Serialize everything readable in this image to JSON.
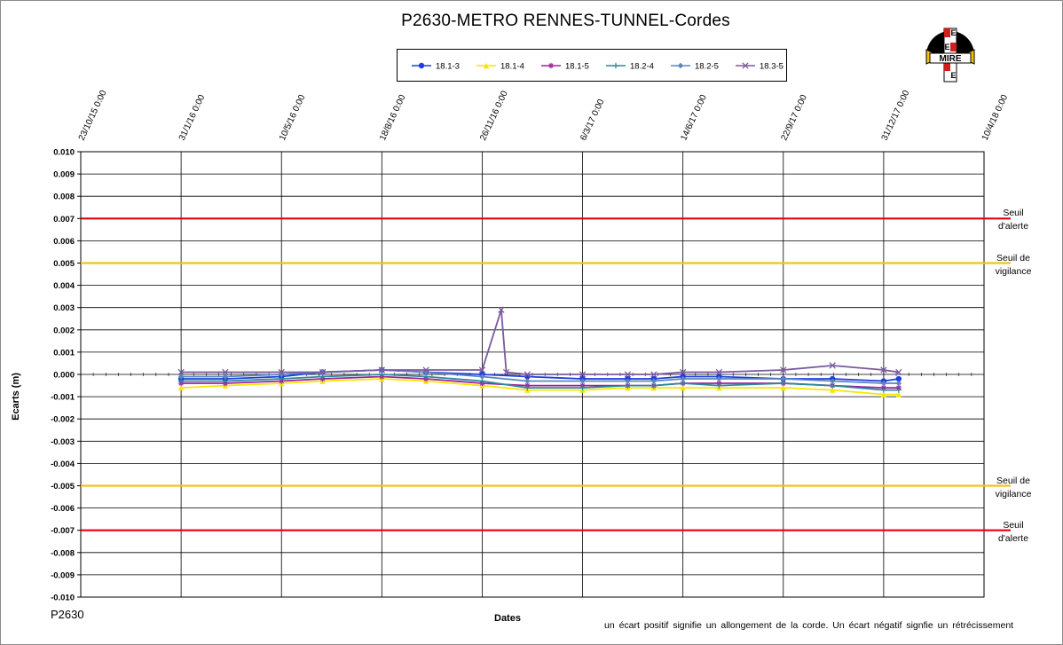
{
  "chart_data": {
    "type": "line",
    "title": "P2630-METRO  RENNES-TUNNEL-Cordes",
    "xlabel": "Dates",
    "ylabel": "Ecarts (m)",
    "x_ticks": [
      "23/10/15 0:00",
      "31/1/16 0:00",
      "10/5/16 0:00",
      "18/8/16 0:00",
      "26/11/16 0:00",
      "6/3/17 0:00",
      "14/6/17 0:00",
      "22/9/17 0:00",
      "31/12/17 0:00",
      "10/4/18 0:00"
    ],
    "x_range": [
      "2015-10-23",
      "2018-04-10"
    ],
    "y_ticks": [
      "0.010",
      "0.009",
      "0.008",
      "0.007",
      "0.006",
      "0.005",
      "0.004",
      "0.003",
      "0.002",
      "0.001",
      "0.000",
      "-0.001",
      "-0.002",
      "-0.003",
      "-0.004",
      "-0.005",
      "-0.006",
      "-0.007",
      "-0.008",
      "-0.009",
      "-0.010"
    ],
    "ylim": [
      -0.01,
      0.01
    ],
    "grid": "horizontal and vertical",
    "legend_position": "top-center",
    "thresholds": [
      {
        "value": 0.007,
        "color": "#e8000b",
        "label_line1": "Seuil",
        "label_line2": "d'alerte"
      },
      {
        "value": 0.005,
        "color": "#f2c01e",
        "label_line1": "Seuil de",
        "label_line2": "vigilance"
      },
      {
        "value": -0.005,
        "color": "#f2c01e",
        "label_line1": "Seuil de",
        "label_line2": "vigilance"
      },
      {
        "value": -0.007,
        "color": "#e8000b",
        "label_line1": "Seuil",
        "label_line2": "d'alerte"
      }
    ],
    "series": [
      {
        "name": "18.1-3",
        "color": "#1f3de0",
        "marker": "circle",
        "x": [
          "2016-01-31",
          "2016-03-15",
          "2016-05-10",
          "2016-06-20",
          "2016-08-18",
          "2016-10-01",
          "2016-11-26",
          "2017-01-10",
          "2017-03-06",
          "2017-04-20",
          "2017-05-16",
          "2017-06-14",
          "2017-07-20",
          "2017-09-22",
          "2017-11-10",
          "2017-12-31",
          "2018-01-15"
        ],
        "y": [
          -0.0002,
          -0.0002,
          -0.0001,
          0.0001,
          0.0002,
          0.0001,
          0.0,
          -0.0001,
          -0.0002,
          -0.0002,
          -0.0002,
          -0.0001,
          -0.0001,
          -0.0002,
          -0.0002,
          -0.0003,
          -0.0002
        ]
      },
      {
        "name": "18.1-4",
        "color": "#f5e600",
        "marker": "triangle",
        "x": [
          "2016-01-31",
          "2016-03-15",
          "2016-05-10",
          "2016-06-20",
          "2016-08-18",
          "2016-10-01",
          "2016-11-26",
          "2017-01-10",
          "2017-03-06",
          "2017-04-20",
          "2017-05-16",
          "2017-06-14",
          "2017-07-20",
          "2017-09-22",
          "2017-11-10",
          "2017-12-31",
          "2018-01-15"
        ],
        "y": [
          -0.0006,
          -0.0005,
          -0.0004,
          -0.0003,
          -0.0002,
          -0.0003,
          -0.0005,
          -0.0007,
          -0.0007,
          -0.0006,
          -0.0006,
          -0.0006,
          -0.0006,
          -0.0006,
          -0.0007,
          -0.0009,
          -0.0009
        ]
      },
      {
        "name": "18.1-5",
        "color": "#a020a0",
        "marker": "star",
        "x": [
          "2016-01-31",
          "2016-03-15",
          "2016-05-10",
          "2016-06-20",
          "2016-08-18",
          "2016-10-01",
          "2016-11-26",
          "2017-01-10",
          "2017-03-06",
          "2017-04-20",
          "2017-05-16",
          "2017-06-14",
          "2017-07-20",
          "2017-09-22",
          "2017-11-10",
          "2017-12-31",
          "2018-01-15"
        ],
        "y": [
          -0.0004,
          -0.0004,
          -0.0003,
          -0.0002,
          -0.0001,
          -0.0002,
          -0.0004,
          -0.0005,
          -0.0005,
          -0.0005,
          -0.0005,
          -0.0004,
          -0.0004,
          -0.0004,
          -0.0005,
          -0.0006,
          -0.0006
        ]
      },
      {
        "name": "18.2-4",
        "color": "#2a8a9a",
        "marker": "plus",
        "x": [
          "2016-01-31",
          "2016-03-15",
          "2016-05-10",
          "2016-06-20",
          "2016-08-18",
          "2016-10-01",
          "2016-11-26",
          "2017-01-10",
          "2017-03-06",
          "2017-04-20",
          "2017-05-16",
          "2017-06-14",
          "2017-07-20",
          "2017-09-22",
          "2017-11-10",
          "2017-12-31",
          "2018-01-15"
        ],
        "y": [
          -0.0003,
          -0.0003,
          -0.0002,
          -0.0001,
          0.0,
          -0.0001,
          -0.0003,
          -0.0006,
          -0.0006,
          -0.0005,
          -0.0005,
          -0.0004,
          -0.0005,
          -0.0004,
          -0.0005,
          -0.0007,
          -0.0007
        ]
      },
      {
        "name": "18.2-5",
        "color": "#5a86c0",
        "marker": "diamond",
        "x": [
          "2016-01-31",
          "2016-03-15",
          "2016-05-10",
          "2016-06-20",
          "2016-08-18",
          "2016-10-01",
          "2016-11-26",
          "2017-01-10",
          "2017-03-06",
          "2017-04-20",
          "2017-05-16",
          "2017-06-14",
          "2017-07-20",
          "2017-09-22",
          "2017-11-10",
          "2017-12-31",
          "2018-01-15"
        ],
        "y": [
          -0.0001,
          -0.0001,
          0.0,
          0.0001,
          0.0002,
          0.0001,
          -0.0001,
          -0.0003,
          -0.0003,
          -0.0003,
          -0.0003,
          -0.0002,
          -0.0002,
          -0.0002,
          -0.0003,
          -0.0004,
          -0.0004
        ]
      },
      {
        "name": "18.3-5",
        "color": "#7b5a9e",
        "marker": "x",
        "x": [
          "2016-01-31",
          "2016-03-15",
          "2016-05-10",
          "2016-06-20",
          "2016-08-18",
          "2016-10-01",
          "2016-11-26",
          "2016-12-15",
          "2016-12-20",
          "2017-01-10",
          "2017-03-06",
          "2017-04-20",
          "2017-05-16",
          "2017-06-14",
          "2017-07-20",
          "2017-09-22",
          "2017-11-10",
          "2017-12-31",
          "2018-01-15"
        ],
        "y": [
          0.0001,
          0.0001,
          0.0001,
          0.0001,
          0.0002,
          0.0002,
          0.0002,
          0.0029,
          0.0001,
          0.0,
          0.0,
          0.0,
          0.0,
          0.0001,
          0.0001,
          0.0002,
          0.0004,
          0.0002,
          0.0001
        ]
      }
    ]
  },
  "footer": {
    "chart_id": "P2630",
    "note": "un écart positif signifie un allongement de la corde. Un écart négatif signfie un rétrécissement"
  },
  "logo": {
    "text": "MIRE",
    "side_letters": [
      "E",
      "E",
      "E"
    ],
    "accent": "#d01f1f"
  }
}
